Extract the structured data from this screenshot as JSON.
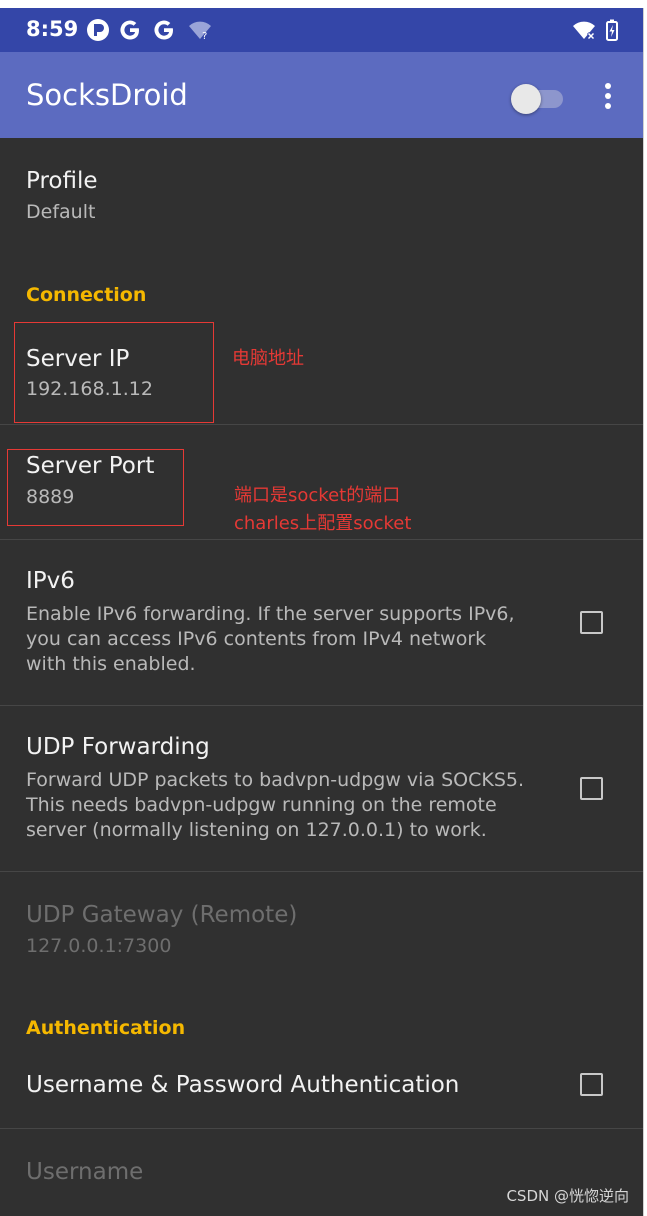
{
  "status_bar": {
    "time": "8:59",
    "icons": [
      "p-app-icon",
      "google-icon",
      "google-icon",
      "wifi-question-icon"
    ],
    "right_icons": [
      "wifi-off-icon",
      "battery-charging-icon"
    ]
  },
  "app_bar": {
    "title": "SocksDroid",
    "switch_on": false,
    "menu_icon": "more-vert-icon"
  },
  "profile": {
    "title": "Profile",
    "summary": "Default"
  },
  "connection": {
    "header": "Connection",
    "server_ip": {
      "title": "Server IP",
      "summary": "192.168.1.12"
    },
    "server_port": {
      "title": "Server Port",
      "summary": "8889"
    },
    "ipv6": {
      "title": "IPv6",
      "summary_lines": [
        "Enable IPv6 forwarding. If the server supports IPv6,",
        "you can access IPv6 contents from IPv4 network",
        "with this enabled."
      ],
      "checked": false
    },
    "udp_forwarding": {
      "title": "UDP Forwarding",
      "summary_lines": [
        "Forward UDP packets to badvpn-udpgw via SOCKS5.",
        "This needs badvpn-udpgw running on the remote",
        "server (normally listening on 127.0.0.1) to work."
      ],
      "checked": false
    },
    "udp_gateway": {
      "title": "UDP Gateway (Remote)",
      "summary": "127.0.0.1:7300",
      "enabled": false
    }
  },
  "authentication": {
    "header": "Authentication",
    "user_pass": {
      "title": "Username & Password Authentication",
      "checked": false
    },
    "username": {
      "title": "Username",
      "enabled": false
    }
  },
  "annotations": {
    "server_ip_note": "电脑地址",
    "server_port_note_lines": [
      "端口是socket的端口",
      "charles上配置socket"
    ],
    "color": "#e53935"
  },
  "watermark": "CSDN @恍惚逆向",
  "colors": {
    "status_bar": "#3446a8",
    "app_bar": "#5c6bc0",
    "background": "#303030",
    "category": "#f5b800"
  }
}
